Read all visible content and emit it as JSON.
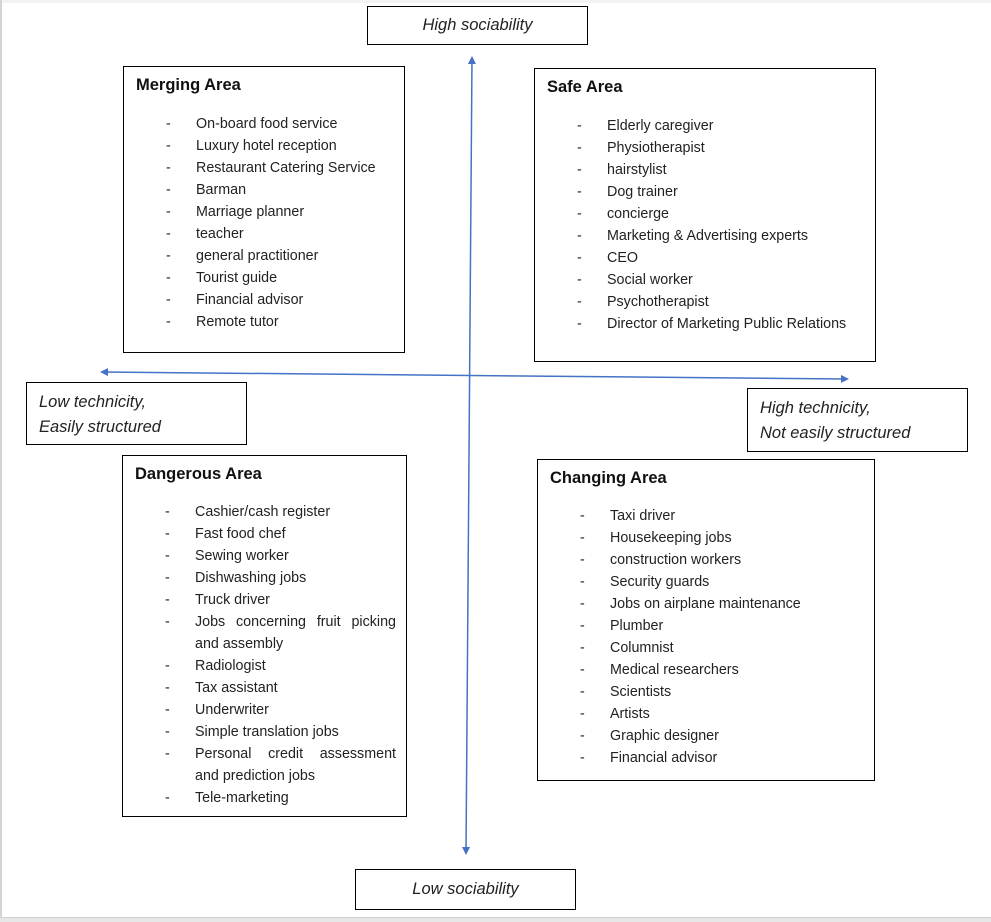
{
  "axes": {
    "top_label": "High sociability",
    "bottom_label": "Low sociability",
    "left_label_lines": [
      "Low technicity,",
      "Easily structured"
    ],
    "right_label_lines": [
      "High technicity,",
      "Not easily structured"
    ],
    "arrow_color": "#4472c4"
  },
  "quadrants": {
    "merging": {
      "title": "Merging Area",
      "items": [
        "On-board food service",
        "Luxury hotel reception",
        "Restaurant Catering Service",
        "Barman",
        "Marriage planner",
        "teacher",
        "general practitioner",
        "Tourist guide",
        "Financial advisor",
        "Remote tutor"
      ]
    },
    "safe": {
      "title": "Safe Area",
      "items": [
        "Elderly caregiver",
        "Physiotherapist",
        "hairstylist",
        "Dog trainer",
        "concierge",
        "Marketing & Advertising experts",
        "CEO",
        "Social worker",
        "Psychotherapist",
        "Director of Marketing Public Relations"
      ]
    },
    "dangerous": {
      "title": "Dangerous Area",
      "items": [
        "Cashier/cash register",
        "Fast food chef",
        "Sewing worker",
        "Dishwashing jobs",
        "Truck driver",
        "Jobs concerning fruit picking and assembly",
        "Radiologist",
        "Tax assistant",
        "Underwriter",
        "Simple translation jobs",
        "Personal credit assessment and prediction jobs",
        "Tele-marketing"
      ]
    },
    "changing": {
      "title": "Changing Area",
      "items": [
        "Taxi driver",
        "Housekeeping jobs",
        "construction workers",
        "Security guards",
        "Jobs on airplane maintenance",
        "Plumber",
        "Columnist",
        "Medical researchers",
        "Scientists",
        "Artists",
        "Graphic designer",
        "Financial advisor"
      ]
    },
    "bullet": "-"
  }
}
